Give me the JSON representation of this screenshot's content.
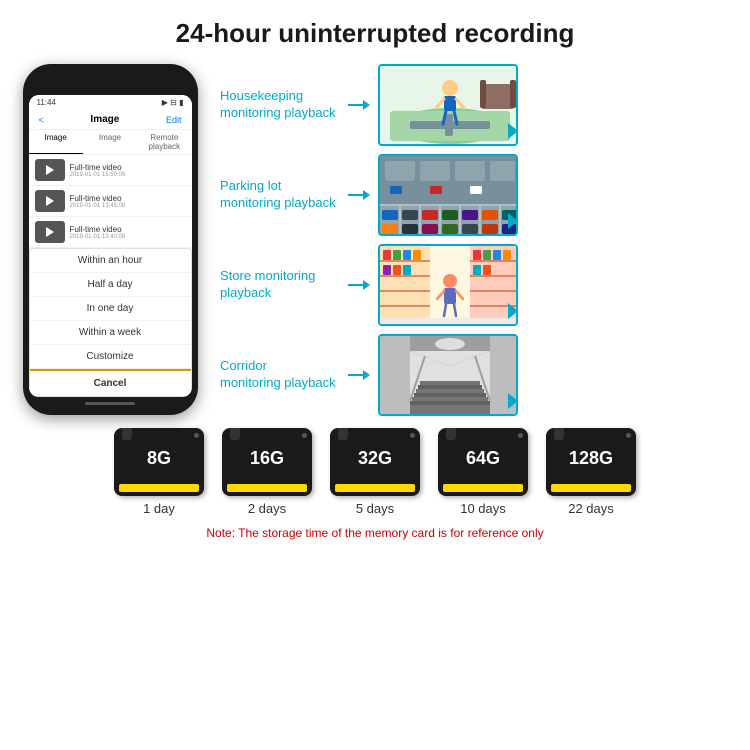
{
  "header": {
    "title": "24-hour uninterrupted recording"
  },
  "phone": {
    "time": "11:44",
    "nav_back": "<",
    "nav_title": "Image",
    "nav_edit": "Edit",
    "tabs": [
      "Image",
      "Image",
      "Remote playback"
    ],
    "videos": [
      {
        "label": "Full-time video",
        "date": "2019-01-01 15:50:06"
      },
      {
        "label": "Full-time video",
        "date": "2019-01-01 13:45:08"
      },
      {
        "label": "Full-time video",
        "date": "2019-01-01 13:40:08"
      }
    ],
    "dropdown": {
      "items": [
        "Within an hour",
        "Half a day",
        "In one day",
        "Within a week",
        "Customize"
      ],
      "cancel": "Cancel"
    }
  },
  "monitoring": [
    {
      "label": "Housekeeping\nmonitoring playback",
      "scene": "kids"
    },
    {
      "label": "Parking lot\nmonitoring playback",
      "scene": "parking"
    },
    {
      "label": "Store monitoring\nplayback",
      "scene": "store"
    },
    {
      "label": "Corridor\nmonitoring playback",
      "scene": "corridor"
    }
  ],
  "storage": {
    "cards": [
      {
        "size": "8G",
        "days": "1 day"
      },
      {
        "size": "16G",
        "days": "2 days"
      },
      {
        "size": "32G",
        "days": "5 days"
      },
      {
        "size": "64G",
        "days": "10 days"
      },
      {
        "size": "128G",
        "days": "22 days"
      }
    ],
    "note": "Note: The storage time of the memory card is for reference only"
  },
  "colors": {
    "accent": "#00aacc",
    "note_red": "#cc0000",
    "phone_bg": "#1a1a1a"
  }
}
